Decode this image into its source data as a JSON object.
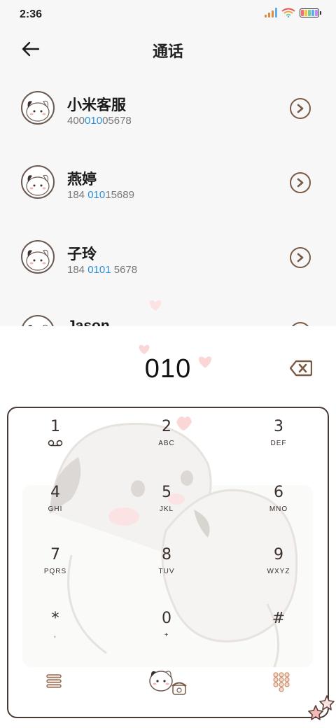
{
  "status_bar": {
    "time": "2:36",
    "battery_colors": [
      "#f07070",
      "#f5c542",
      "#6fcf97",
      "#5ab0f0",
      "#c58af0"
    ]
  },
  "header": {
    "title": "通话",
    "back_icon": "arrow-left-icon"
  },
  "contacts": [
    {
      "name": "小米客服",
      "number_parts": [
        "400",
        "010",
        "05678"
      ]
    },
    {
      "name": "燕婷",
      "number_parts": [
        "184 ",
        "010",
        "15689"
      ]
    },
    {
      "name": "子玲",
      "number_parts": [
        "184 ",
        "0101",
        " 5678"
      ]
    },
    {
      "name": "Jason",
      "number_parts": [
        "",
        "",
        ""
      ]
    }
  ],
  "dialer": {
    "input_value": "010",
    "delete_icon": "backspace-icon"
  },
  "keypad": {
    "keys": [
      {
        "digit": "1",
        "letters": ""
      },
      {
        "digit": "2",
        "letters": "ABC"
      },
      {
        "digit": "3",
        "letters": "DEF"
      },
      {
        "digit": "4",
        "letters": "GHI"
      },
      {
        "digit": "5",
        "letters": "JKL"
      },
      {
        "digit": "6",
        "letters": "MNO"
      },
      {
        "digit": "7",
        "letters": "PQRS"
      },
      {
        "digit": "8",
        "letters": "TUV"
      },
      {
        "digit": "9",
        "letters": "WXYZ"
      },
      {
        "digit": "*",
        "letters": ","
      },
      {
        "digit": "0",
        "letters": "+"
      },
      {
        "digit": "#",
        "letters": ""
      }
    ],
    "bottom": {
      "menu_icon": "menu-icon",
      "call_icon": "call-cat-icon",
      "keypad_icon": "keypad-grid-icon"
    }
  },
  "colors": {
    "highlight": "#2a8fd6",
    "accent_brown": "#7a5a44",
    "border_dark": "#4a3b36"
  }
}
